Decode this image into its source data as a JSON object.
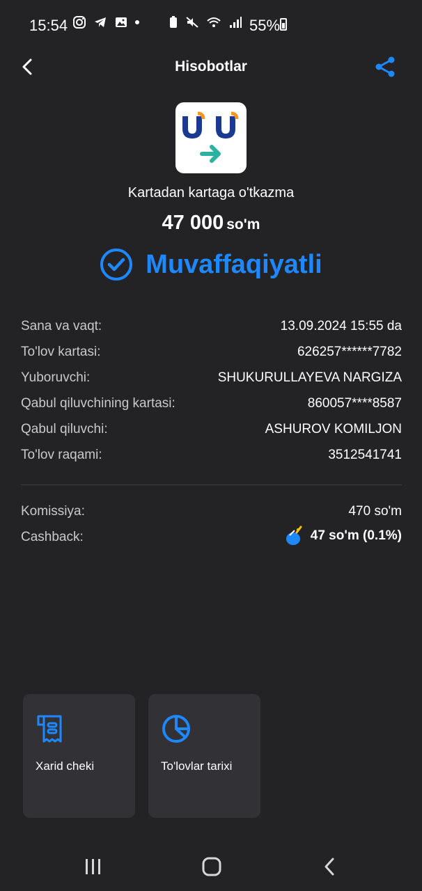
{
  "status_bar": {
    "time": "15:54",
    "battery": "55%"
  },
  "header": {
    "title": "Hisobotlar"
  },
  "service": {
    "name": "Kartadan kartaga o'tkazma"
  },
  "amount": {
    "value": "47 000",
    "unit": "so'm"
  },
  "status": {
    "label": "Muvaffaqiyatli"
  },
  "details": [
    {
      "key": "Sana va vaqt:",
      "value": "13.09.2024 15:55 da"
    },
    {
      "key": "To'lov kartasi:",
      "value": "626257******7782"
    },
    {
      "key": "Yuboruvchi:",
      "value": "SHUKURULLAYEVA NARGIZA"
    },
    {
      "key": "Qabul qiluvchining kartasi:",
      "value": "860057****8587"
    },
    {
      "key": "Qabul qiluvchi:",
      "value": "ASHUROV KOMILJON"
    },
    {
      "key": "To'lov raqami:",
      "value": "3512541741"
    }
  ],
  "fees": {
    "commission_label": "Komissiya:",
    "commission_value": "470 so'm",
    "cashback_label": "Cashback:",
    "cashback_value": "47 so'm (0.1%)"
  },
  "actions": [
    {
      "label": "Xarid cheki",
      "icon": "receipt-icon"
    },
    {
      "label": "To'lovlar tarixi",
      "icon": "pie-chart-icon"
    }
  ],
  "colors": {
    "accent": "#1e88ff",
    "background": "#232325",
    "tile": "#313136"
  }
}
